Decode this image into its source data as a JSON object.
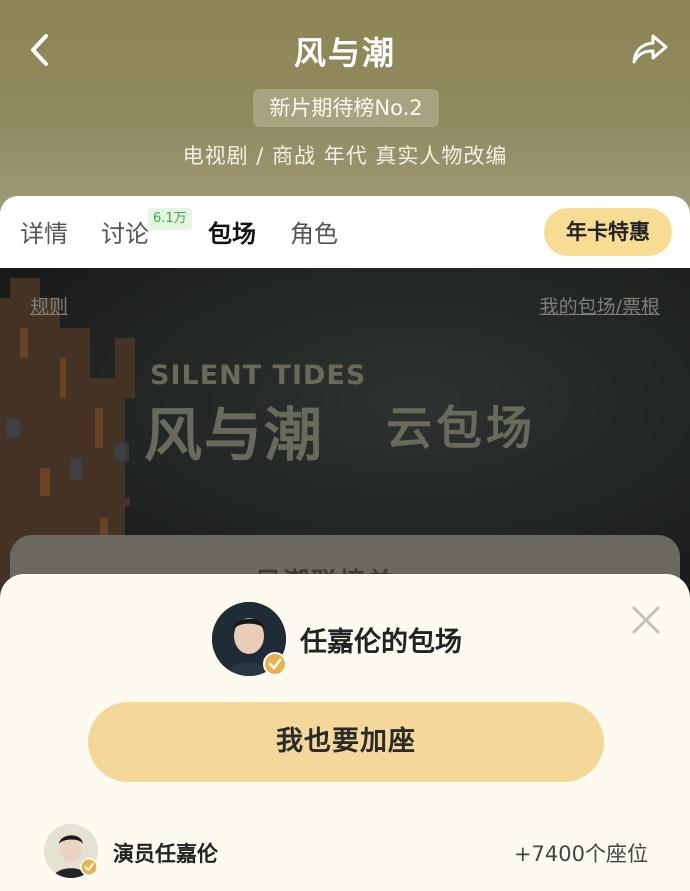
{
  "header": {
    "title": "风与潮",
    "rank_badge": "新片期待榜No.2",
    "genre": "电视剧 / 商战 年代 真实人物改编"
  },
  "tabs": [
    {
      "label": "详情",
      "active": false
    },
    {
      "label": "讨论",
      "active": false,
      "badge": "6.1万"
    },
    {
      "label": "包场",
      "active": true
    },
    {
      "label": "角色",
      "active": false
    }
  ],
  "annual_offer_label": "年卡特惠",
  "banner": {
    "rules_link": "规则",
    "my_link": "我的包场/票根",
    "en_title": "SILENT TIDES",
    "cn_title": "风与潮",
    "cn_subtitle": "云包场",
    "under_card_text": "风潮联榜单"
  },
  "sheet": {
    "title": "任嘉伦的包场",
    "join_button": "我也要加座",
    "row": {
      "name": "演员任嘉伦",
      "seats": "+7400个座位"
    }
  },
  "colors": {
    "header_bg": "#8c8656",
    "accent_gold": "#f4d899",
    "verified": "#e9b24a",
    "tab_badge_text": "#3aa84a"
  },
  "icons": {
    "back": "back-arrow-icon",
    "share": "share-icon",
    "close": "close-icon",
    "verified": "verified-badge-icon"
  }
}
